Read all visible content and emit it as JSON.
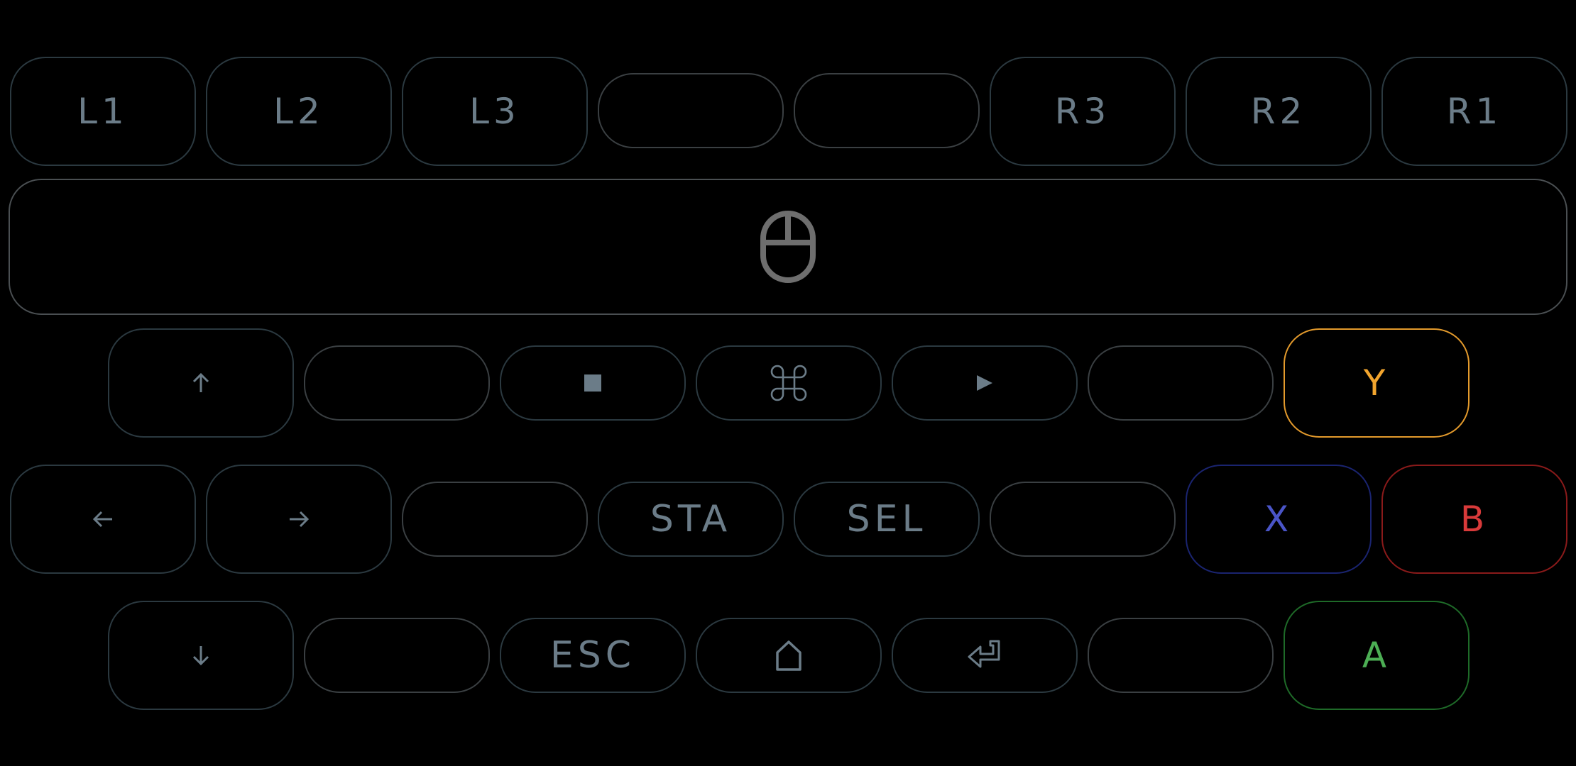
{
  "top_row": {
    "l1": "L1",
    "l2": "L2",
    "l3": "L3",
    "r3": "R3",
    "r2": "R2",
    "r1": "R1"
  },
  "mouse_area": {
    "icon": "mouse-icon"
  },
  "dpad": {
    "up_icon": "arrow-up-icon",
    "left_icon": "arrow-left-icon",
    "right_icon": "arrow-right-icon",
    "down_icon": "arrow-down-icon"
  },
  "media": {
    "stop_icon": "stop-square-icon",
    "command_icon": "command-icon",
    "play_icon": "play-triangle-icon"
  },
  "system": {
    "start": "STA",
    "select": "SEL",
    "escape": "ESC",
    "home_icon": "home-icon",
    "enter_icon": "enter-return-icon"
  },
  "face_buttons": {
    "y": "Y",
    "x": "X",
    "b": "B",
    "a": "A"
  },
  "colors": {
    "background": "#000000",
    "key_border": "#2b3940",
    "blank_border": "#3a3f42",
    "label": "#6b7c88",
    "y": "#f2a52e",
    "x": "#4a55c8",
    "x_border": "#1a2470",
    "b": "#d83a3a",
    "b_border": "#8a1a1a",
    "a": "#4cae54",
    "a_border": "#1e6a28"
  }
}
